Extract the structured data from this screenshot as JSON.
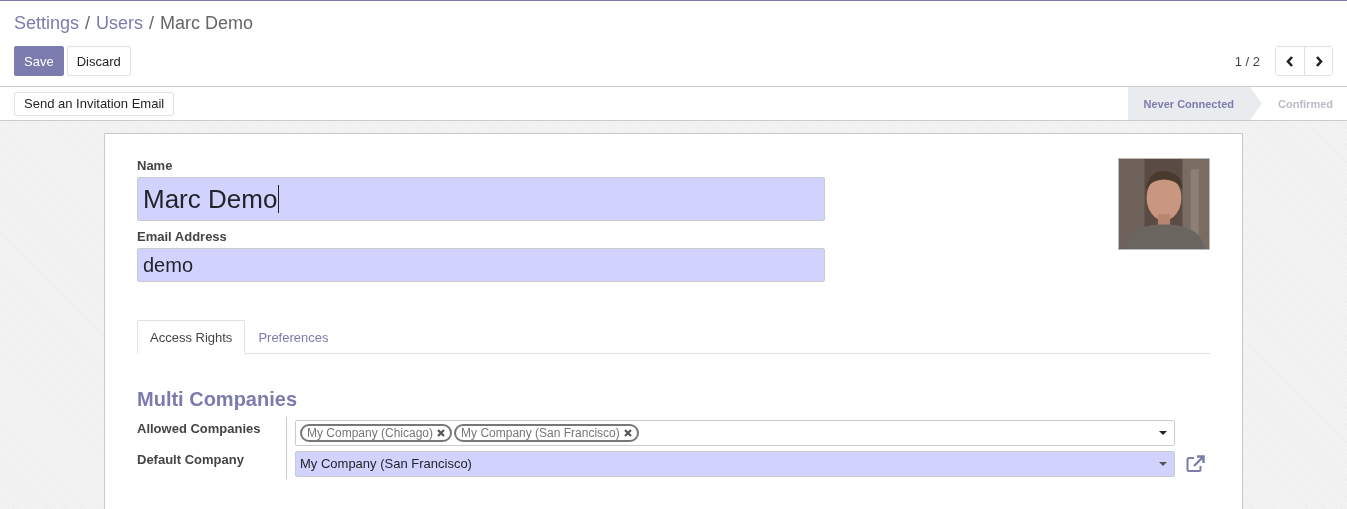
{
  "breadcrumbs": [
    {
      "label": "Settings",
      "kind": "link"
    },
    {
      "label": "/",
      "kind": "separator"
    },
    {
      "label": "Users",
      "kind": "link"
    },
    {
      "label": "/",
      "kind": "separator"
    },
    {
      "label": "Marc Demo",
      "kind": "current"
    }
  ],
  "buttons": [
    {
      "label": "Save",
      "kind": "primary"
    },
    {
      "label": "Discard",
      "kind": "secondary"
    }
  ],
  "pager": {
    "value": "1 / 2"
  },
  "header_button": "Send an Invitation Email",
  "stages": [
    {
      "label": "Never Connected",
      "selected": true
    },
    {
      "label": "Confirmed",
      "selected": false
    }
  ],
  "fields": [
    {
      "label": "Name",
      "value": "Marc Demo",
      "kind": "title"
    },
    {
      "label": "Email Address",
      "value": "demo",
      "kind": "text"
    }
  ],
  "tabs": [
    {
      "label": "Access Rights",
      "selected": true
    },
    {
      "label": "Preferences",
      "selected": false
    }
  ],
  "section_title": "Multi Companies",
  "allowed_companies": {
    "label": "Allowed Companies",
    "tags": [
      "My Company (Chicago)",
      "My Company (San Francisco)"
    ]
  },
  "default_company": {
    "label": "Default Company",
    "value": "My Company (San Francisco)"
  }
}
